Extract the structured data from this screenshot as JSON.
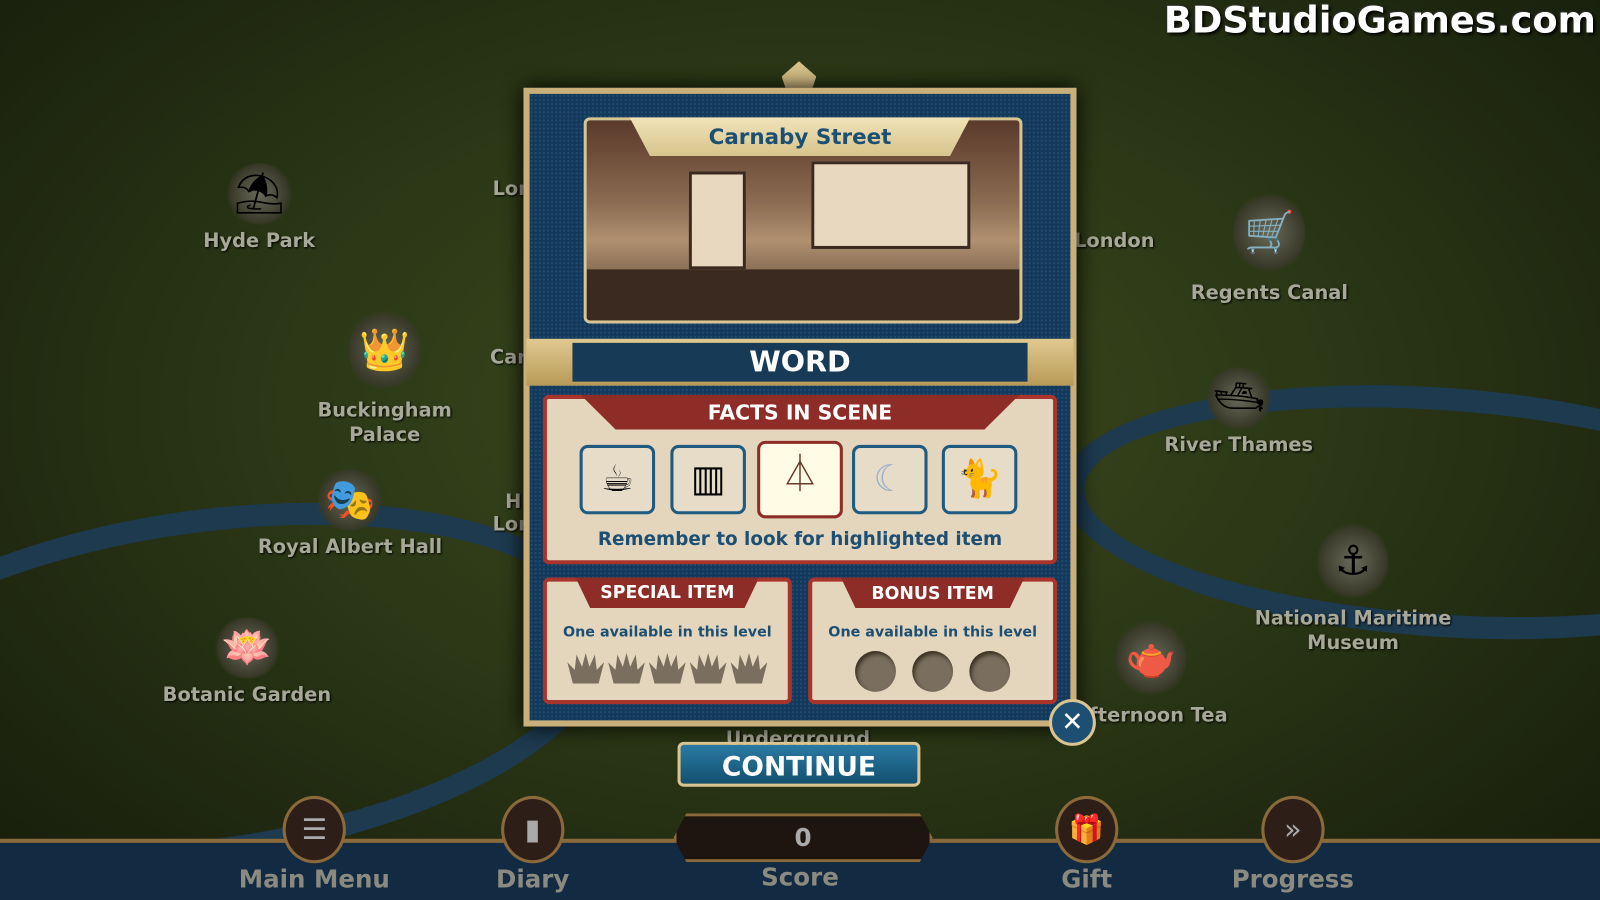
{
  "watermark": "BDStudioGames.com",
  "map": {
    "locations": [
      {
        "label": "Hyde Park",
        "icon": "beach-chair-icon"
      },
      {
        "label": "Buckingham Palace",
        "icon": "crown-icon"
      },
      {
        "label": "Royal Albert Hall",
        "icon": "mask-icon"
      },
      {
        "label": "Botanic Garden",
        "icon": "lotus-icon"
      },
      {
        "label": "London",
        "icon": "map-pin-icon"
      },
      {
        "label": "Regents Canal",
        "icon": "pram-icon"
      },
      {
        "label": "River Thames",
        "icon": "boat-icon"
      },
      {
        "label": "National Maritime Museum",
        "icon": "anchor-icon"
      },
      {
        "label": "Afternoon Tea",
        "icon": "teapot-icon"
      }
    ],
    "partial_labels": [
      "Lor",
      "Carn",
      "H",
      "Lor",
      "Underground"
    ]
  },
  "dialog": {
    "scene_title": "Carnaby Street",
    "mode": "WORD",
    "facts": {
      "title": "FACTS IN SCENE",
      "items": [
        {
          "name": "coffee-maker",
          "glyph": "☕",
          "highlighted": false
        },
        {
          "name": "barcode",
          "glyph": "▥",
          "highlighted": false
        },
        {
          "name": "eiffel-tower",
          "glyph": "⏃",
          "highlighted": true
        },
        {
          "name": "moon",
          "glyph": "☾",
          "highlighted": false
        },
        {
          "name": "cat",
          "glyph": "🐈",
          "highlighted": false
        }
      ],
      "hint": "Remember to look for highlighted item"
    },
    "special": {
      "title": "SPECIAL ITEM",
      "text": "One available in this level",
      "crowns_found": 0,
      "crowns_total": 5
    },
    "bonus": {
      "title": "BONUS ITEM",
      "text": "One available in this level",
      "coins_found": 0,
      "coins_total": 3
    },
    "continue_label": "CONTINUE",
    "close_glyph": "✕"
  },
  "bottom": {
    "main_menu": "Main Menu",
    "diary": "Diary",
    "score_label": "Score",
    "score": "0",
    "gift": "Gift",
    "progress": "Progress"
  },
  "colors": {
    "panel_red": "#8e2d27",
    "panel_blue": "#14385a",
    "gold": "#c9b07a",
    "text_blue": "#1d4f73"
  }
}
